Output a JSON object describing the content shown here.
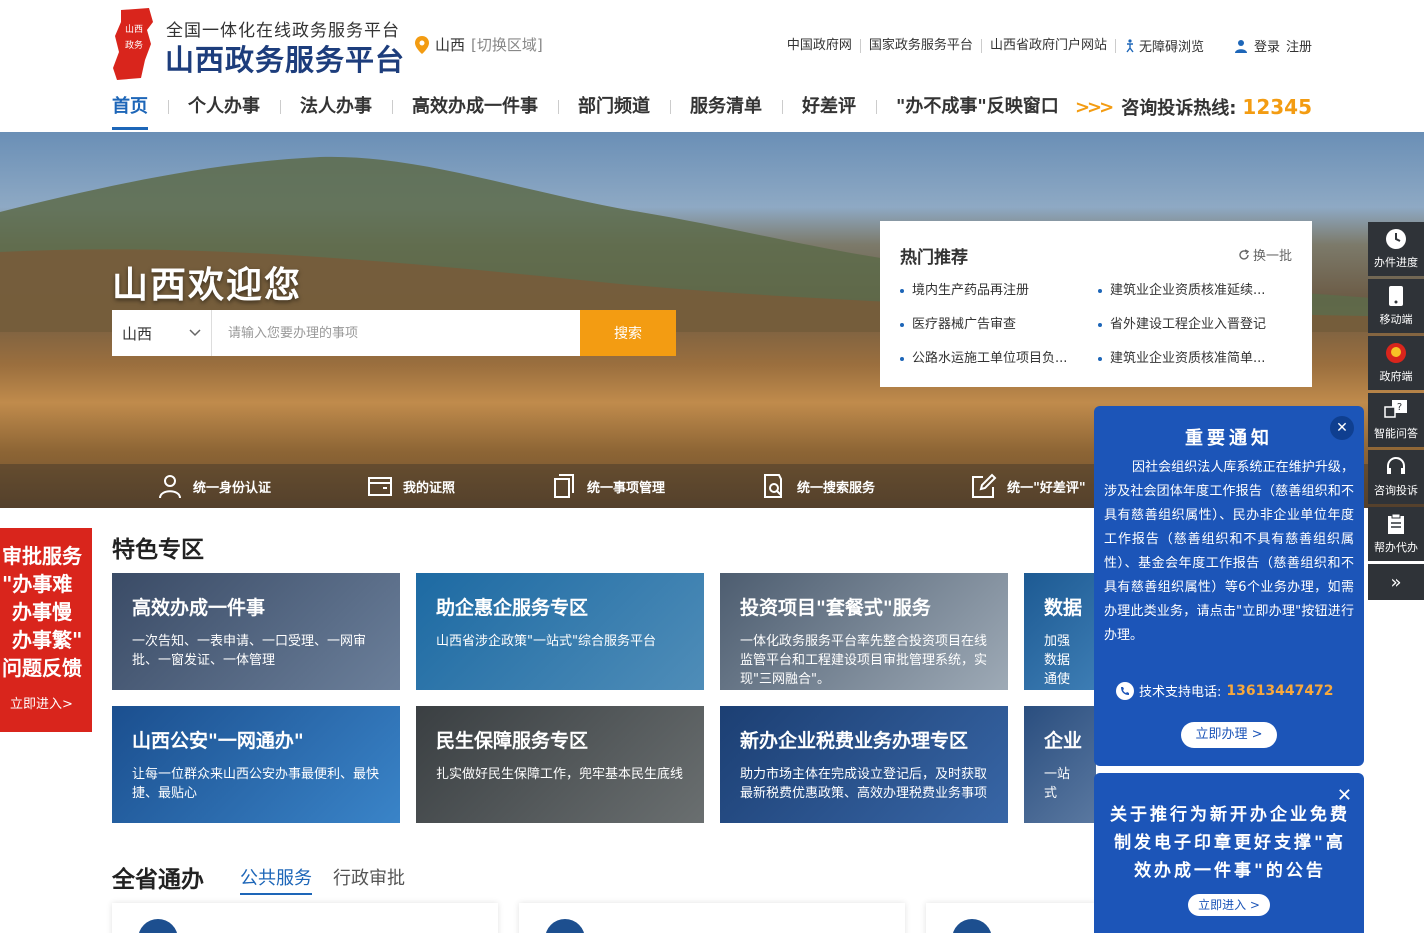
{
  "header": {
    "logo_emblem_text": "山西政务",
    "logo_sub": "全国一体化在线政务服务平台",
    "logo_main": "山西政务服务平台",
    "region_name": "山西",
    "region_switch": "[切换区域]",
    "top_links": [
      "中国政府网",
      "国家政务服务平台",
      "山西省政府门户网站"
    ],
    "accessibility": "无障碍浏览",
    "login": "登录",
    "register": "注册"
  },
  "nav": {
    "items": [
      "首页",
      "个人办事",
      "法人办事",
      "高效办成一件事",
      "部门频道",
      "服务清单",
      "好差评",
      "\"办不成事\"反映窗口"
    ],
    "hotline_arrows": ">>>",
    "hotline_label": "咨询投诉热线:",
    "hotline_number": "12345"
  },
  "banner": {
    "welcome": "山西欢迎您",
    "search_region": "山西",
    "search_placeholder": "请输入您要办理的事项",
    "search_button": "搜索"
  },
  "hot": {
    "title": "热门推荐",
    "refresh": "换一批",
    "items": [
      "境内生产药品再注册",
      "建筑业企业资质核准延续...",
      "医疗器械广告审查",
      "省外建设工程企业入晋登记",
      "公路水运施工单位项目负...",
      "建筑业企业资质核准简单..."
    ]
  },
  "quickbar": [
    "统一身份认证",
    "我的证照",
    "统一事项管理",
    "统一搜索服务",
    "统一\"好差评\""
  ],
  "left_float": {
    "lines": [
      "审批服务",
      "\"办事难",
      "办事慢",
      "办事繁\"",
      "问题反馈"
    ],
    "enter": "立即进入>"
  },
  "right_side": [
    "办件进度",
    "移动端",
    "政府端",
    "智能问答",
    "咨询投诉",
    "帮办代办",
    "»"
  ],
  "feature": {
    "title": "特色专区",
    "cards": [
      {
        "title": "高效办成一件事",
        "desc": "一次告知、一表申请、一口受理、一网审批、一窗发证、一体管理"
      },
      {
        "title": "助企惠企服务专区",
        "desc": "山西省涉企政策\"一站式\"综合服务平台"
      },
      {
        "title": "投资项目\"套餐式\"服务",
        "desc": "一体化政务服务平台率先整合投资项目在线监管平台和工程建设项目审批管理系统，实现\"三网融合\"。"
      },
      {
        "title": "数据",
        "desc": "加强数据通使用"
      },
      {
        "title": "山西公安\"一网通办\"",
        "desc": "让每一位群众来山西公安办事最便利、最快捷、最贴心"
      },
      {
        "title": "民生保障服务专区",
        "desc": "扎实做好民生保障工作，兜牢基本民生底线"
      },
      {
        "title": "新办企业税费业务办理专区",
        "desc": "助力市场主体在完成设立登记后，及时获取最新税费优惠政策、高效办理税费业务事项"
      },
      {
        "title": "企业",
        "desc": "一站式"
      }
    ]
  },
  "province": {
    "title": "全省通办",
    "tab_active": "公共服务",
    "tab_inactive": "行政审批"
  },
  "notice": {
    "title": "重要通知",
    "body": "因社会组织法人库系统正在维护升级，涉及社会团体年度工作报告（慈善组织和不具有慈善组织属性）、民办非企业单位年度工作报告（慈善组织和不具有慈善组织属性）、基金会年度工作报告（慈善组织和不具有慈善组织属性）等6个业务办理，如需办理此类业务，请点击\"立即办理\"按钮进行办理。",
    "tech_label": "技术支持电话:",
    "tech_phone": "13613447472",
    "button": "立即办理 >"
  },
  "notice2": {
    "title": "关于推行为新开办企业免费制发电子印章更好支撑\"高效办成一件事\"的公告",
    "button": "立即进入 >"
  },
  "colors": {
    "brand_blue": "#1d66b8",
    "accent_orange": "#f39c12",
    "emblem_red": "#d9251c",
    "notice_blue": "#1c55b8"
  }
}
